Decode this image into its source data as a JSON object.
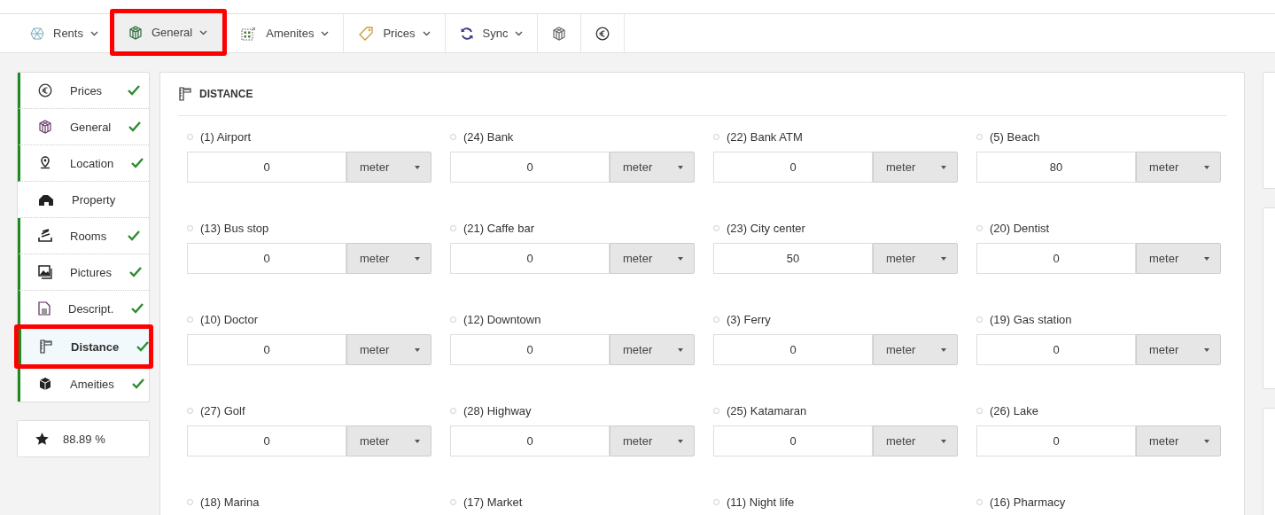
{
  "toolbar": {
    "items": [
      {
        "kind": "menu",
        "label": "Rents",
        "selected": false,
        "highlighted": false
      },
      {
        "kind": "menu",
        "label": "General",
        "selected": true,
        "highlighted": true
      },
      {
        "kind": "menu",
        "label": "Amenites",
        "selected": false,
        "highlighted": false
      },
      {
        "kind": "menu",
        "label": "Prices",
        "selected": false,
        "highlighted": false
      },
      {
        "kind": "menu",
        "label": "Sync",
        "selected": false,
        "highlighted": false
      },
      {
        "kind": "icon",
        "selected": false,
        "highlighted": false
      },
      {
        "kind": "icon",
        "selected": false,
        "highlighted": false
      }
    ]
  },
  "sidebar": {
    "items": [
      {
        "label": "Prices",
        "done": true,
        "selected": false,
        "highlighted": false
      },
      {
        "label": "General",
        "done": true,
        "selected": false,
        "highlighted": false
      },
      {
        "label": "Location",
        "done": true,
        "selected": false,
        "highlighted": false
      },
      {
        "label": "Property",
        "done": false,
        "selected": false,
        "highlighted": false
      },
      {
        "label": "Rooms",
        "done": true,
        "selected": false,
        "highlighted": false
      },
      {
        "label": "Pictures",
        "done": true,
        "selected": false,
        "highlighted": false
      },
      {
        "label": "Descript.",
        "done": true,
        "selected": false,
        "highlighted": false
      },
      {
        "label": "Distance",
        "done": true,
        "selected": true,
        "highlighted": true
      },
      {
        "label": "Ameities",
        "done": true,
        "selected": false,
        "highlighted": false
      }
    ],
    "score": "88.89 %"
  },
  "panel": {
    "title": "DISTANCE",
    "items": [
      {
        "label": "(1) Airport",
        "value": "0",
        "unit": "meter"
      },
      {
        "label": "(24) Bank",
        "value": "0",
        "unit": "meter"
      },
      {
        "label": "(22) Bank ATM",
        "value": "0",
        "unit": "meter"
      },
      {
        "label": "(5) Beach",
        "value": "80",
        "unit": "meter"
      },
      {
        "label": "(13) Bus stop",
        "value": "0",
        "unit": "meter"
      },
      {
        "label": "(21) Caffe bar",
        "value": "0",
        "unit": "meter"
      },
      {
        "label": "(23) City center",
        "value": "50",
        "unit": "meter"
      },
      {
        "label": "(20) Dentist",
        "value": "0",
        "unit": "meter"
      },
      {
        "label": "(10) Doctor",
        "value": "0",
        "unit": "meter"
      },
      {
        "label": "(12) Downtown",
        "value": "0",
        "unit": "meter"
      },
      {
        "label": "(3) Ferry",
        "value": "0",
        "unit": "meter"
      },
      {
        "label": "(19) Gas station",
        "value": "0",
        "unit": "meter"
      },
      {
        "label": "(27) Golf",
        "value": "0",
        "unit": "meter"
      },
      {
        "label": "(28) Highway",
        "value": "0",
        "unit": "meter"
      },
      {
        "label": "(25) Katamaran",
        "value": "0",
        "unit": "meter"
      },
      {
        "label": "(26) Lake",
        "value": "0",
        "unit": "meter"
      },
      {
        "label": "(18) Marina"
      },
      {
        "label": "(17) Market"
      },
      {
        "label": "(11) Night life"
      },
      {
        "label": "(16) Pharmacy"
      }
    ]
  }
}
